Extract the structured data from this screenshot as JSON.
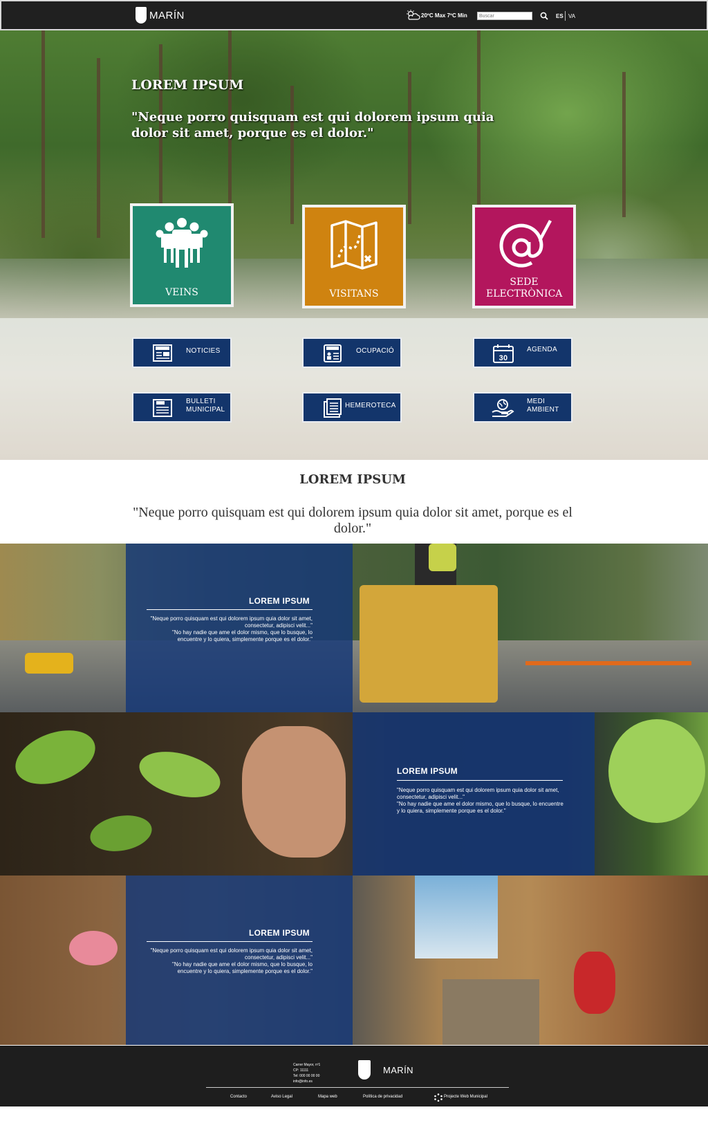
{
  "header": {
    "brand": "MARÍN",
    "weather": "20ºC Max 7ºC Min",
    "search_placeholder": "Buscar",
    "lang_es": "ES",
    "lang_va": "VA"
  },
  "hero": {
    "title": "LOREM IPSUM",
    "quote": "\"Neque porro quisquam est qui dolorem ipsum quia dolor sit amet, porque es el dolor.\"",
    "tiles": [
      {
        "label": "VEINS",
        "color": "#208970",
        "icon": "people-icon"
      },
      {
        "label": "VISITANS",
        "color": "#cf8310",
        "icon": "map-icon"
      },
      {
        "label": "SEDE ELECTRÒNICA",
        "color": "#b3165d",
        "icon": "at-sign-icon"
      }
    ]
  },
  "quick_links": [
    {
      "label": "NOTICIES",
      "icon": "newspaper-icon"
    },
    {
      "label": "OCUPACIÓ",
      "icon": "jobs-icon"
    },
    {
      "label": "AGENDA",
      "icon": "calendar-icon",
      "badge": "30"
    },
    {
      "label": "BULLETI MUNICIPAL",
      "icon": "bulletin-icon"
    },
    {
      "label": "HEMEROTECA",
      "icon": "archive-icon"
    },
    {
      "label": "MEDI AMBIENT",
      "icon": "globe-hand-icon"
    }
  ],
  "section": {
    "title": "LOREM IPSUM",
    "quote": "\"Neque porro quisquam est qui dolorem ipsum quia dolor sit amet, porque es el dolor.\""
  },
  "features": [
    {
      "title": "LOREM IPSUM",
      "text1": "\"Neque porro quisquam est qui dolorem ipsum quia dolor sit amet, consectetur, adipisci velit...\"",
      "text2": "\"No hay nadie que ame el dolor mismo, que lo busque, lo encuentre y lo quiera, simplemente porque es el dolor.\""
    },
    {
      "title": "LOREM IPSUM",
      "text1": "\"Neque porro quisquam est qui dolorem ipsum quia dolor sit amet, consectetur, adipisci velit...\"",
      "text2": "\"No hay nadie que ame el dolor mismo, que lo busque, lo encuentre y lo quiera, simplemente porque es el dolor.\""
    },
    {
      "title": "LOREM IPSUM",
      "text1": "\"Neque porro quisquam est qui dolorem ipsum quia dolor sit amet, consectetur, adipisci velit...\"",
      "text2": "\"No hay nadie que ame el dolor mismo, que lo busque, lo encuentre y lo quiera, simplemente porque es el dolor.\""
    }
  ],
  "footer": {
    "address_line1": "Carrer Mayor, nº1",
    "address_line2": "CP: 11111",
    "address_line3": "Tel: 000 00 00 00",
    "address_line4": "info@info.es",
    "brand": "MARÍN",
    "links": [
      "Contacto",
      "Aviso Legal",
      "Mapa web",
      "Política de privacidad"
    ],
    "project": "Projecte Web Municipal"
  },
  "colors": {
    "header_bg": "#202020",
    "veins": "#208970",
    "visitans": "#cf8310",
    "sede": "#b3165d",
    "navy": "#13356b",
    "panel": "#143778"
  }
}
